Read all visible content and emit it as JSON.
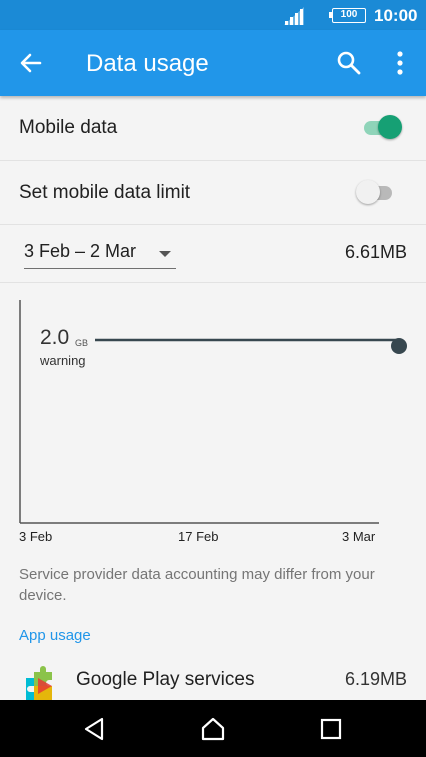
{
  "status_bar": {
    "battery": "100",
    "time": "10:00"
  },
  "app_bar": {
    "title": "Data usage"
  },
  "settings": {
    "mobile_data": {
      "label": "Mobile data",
      "enabled": true
    },
    "data_limit": {
      "label": "Set mobile data limit",
      "enabled": false
    }
  },
  "period": {
    "selected": "3 Feb – 2 Mar",
    "total": "6.61MB"
  },
  "chart": {
    "warning_value": "2.0",
    "warning_unit": "GB",
    "warning_label": "warning",
    "x_ticks": [
      "3 Feb",
      "17 Feb",
      "3 Mar"
    ]
  },
  "note": "Service provider data accounting may differ from your device.",
  "app_usage": {
    "heading": "App usage",
    "items": [
      {
        "name": "Google Play services",
        "size": "6.19MB",
        "icon": "google-play-services-icon"
      }
    ]
  },
  "colors": {
    "status_bar": "#1b8ad6",
    "app_bar": "#2196e9",
    "toggle_on": "#16a074",
    "accent": "#2196e9"
  }
}
